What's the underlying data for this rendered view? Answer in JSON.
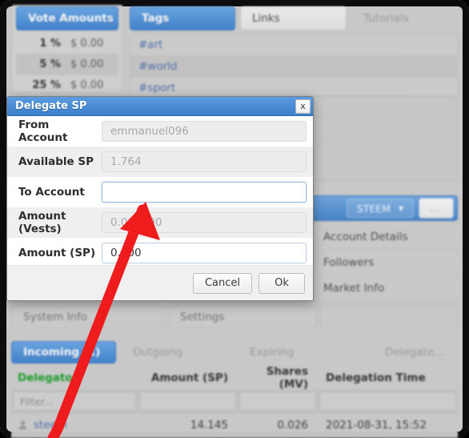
{
  "background": {
    "vote_panel": {
      "tab_label": "Vote Amounts",
      "rows": [
        {
          "percent": "1 %",
          "amount": "$ 0.00"
        },
        {
          "percent": "5 %",
          "amount": "$ 0.00"
        },
        {
          "percent": "25 %",
          "amount": "$ 0.00"
        }
      ]
    },
    "top_tabs": [
      {
        "label": "Tags",
        "state": "active"
      },
      {
        "label": "Links",
        "state": "inactive"
      },
      {
        "label": "Tutorials",
        "state": "disabled"
      }
    ],
    "tags": [
      "#art",
      "#world",
      "#sport"
    ],
    "toolbar": {
      "currency_label": "STEEM",
      "more_label": "..."
    },
    "right_menu": [
      "Account Details",
      "Followers",
      "Market Info"
    ],
    "secondary_tabs": [
      {
        "label": "System Info"
      },
      {
        "label": "Settings"
      }
    ],
    "delegation_tabs": [
      {
        "label": "Incoming (1)",
        "state": "active"
      },
      {
        "label": "Outgoing",
        "state": "inactive"
      },
      {
        "label": "Expiring",
        "state": "inactive"
      },
      {
        "label": "Delegate...",
        "state": "inactive"
      }
    ],
    "table": {
      "columns": [
        "Delegator",
        "Amount (SP)",
        "Shares (MV)",
        "Delegation Time"
      ],
      "filter_placeholder": "Filter...",
      "rows": [
        {
          "delegator": "steem",
          "amount_sp": "14.145",
          "shares_mv": "0.026",
          "delegation_time": "2021-08-31, 15:52"
        }
      ]
    }
  },
  "dialog": {
    "title": "Delegate SP",
    "close_label": "x",
    "fields": [
      {
        "label": "From Account",
        "value": "emmanuel096",
        "state": "readonly"
      },
      {
        "label": "Available SP",
        "value": "1.764",
        "state": "readonly"
      },
      {
        "label": "To Account",
        "value": "",
        "state": "focused"
      },
      {
        "label": "Amount (Vests)",
        "value": "0.000000",
        "state": "readonly"
      },
      {
        "label": "Amount (SP)",
        "value": "0.000",
        "state": "editable"
      }
    ],
    "buttons": {
      "cancel": "Cancel",
      "ok": "Ok"
    }
  },
  "annotation": {
    "arrow_color": "#ee1c1c",
    "points_at": "To Account"
  }
}
